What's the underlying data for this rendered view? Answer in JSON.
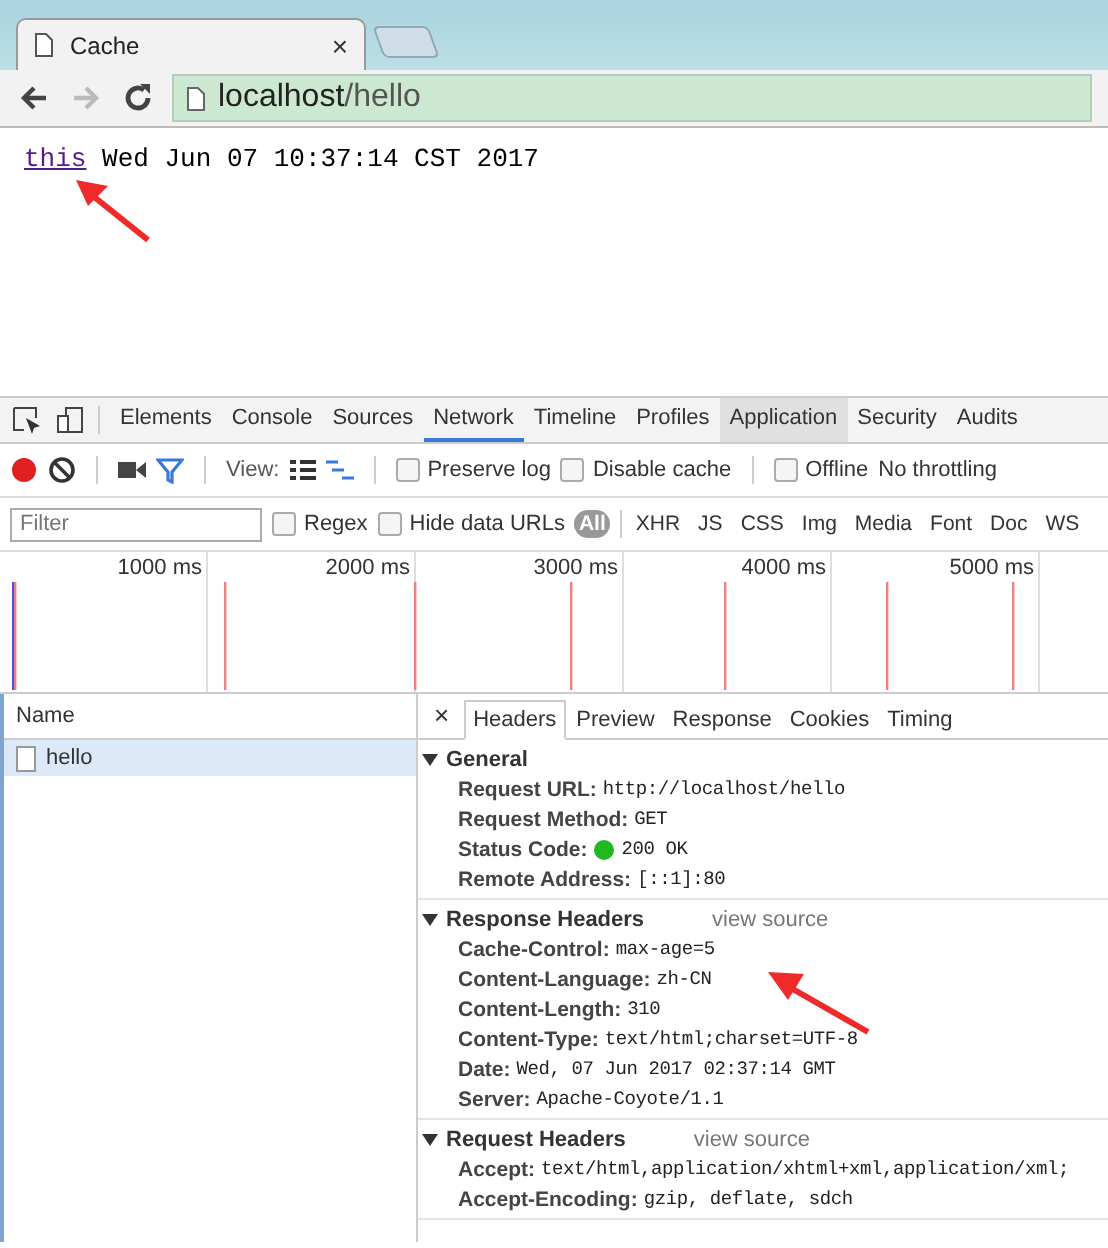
{
  "browser": {
    "tab_title": "Cache",
    "tab_close": "×",
    "address": {
      "host": "localhost",
      "path": "/hello"
    }
  },
  "page": {
    "link": "this",
    "text": "Wed Jun 07 10:37:14 CST 2017"
  },
  "devtools": {
    "panels": [
      {
        "label": "Elements",
        "selected": false
      },
      {
        "label": "Console",
        "selected": false
      },
      {
        "label": "Sources",
        "selected": false
      },
      {
        "label": "Network",
        "selected": true
      },
      {
        "label": "Timeline",
        "selected": false
      },
      {
        "label": "Profiles",
        "selected": false
      },
      {
        "label": "Application",
        "selected": false
      },
      {
        "label": "Security",
        "selected": false
      },
      {
        "label": "Audits",
        "selected": false
      }
    ],
    "toolbar": {
      "recording": true,
      "view_label": "View:",
      "options": [
        {
          "label": "Preserve log",
          "checked": false
        },
        {
          "label": "Disable cache",
          "checked": false
        },
        {
          "label": "Offline",
          "checked": false
        }
      ],
      "throttling": "No throttling"
    },
    "filter": {
      "placeholder": "Filter",
      "options": [
        {
          "label": "Regex",
          "checked": false
        },
        {
          "label": "Hide data URLs",
          "checked": false
        }
      ],
      "types": [
        {
          "label": "All",
          "selected": true
        },
        {
          "label": "XHR",
          "selected": false
        },
        {
          "label": "JS",
          "selected": false
        },
        {
          "label": "CSS",
          "selected": false
        },
        {
          "label": "Img",
          "selected": false
        },
        {
          "label": "Media",
          "selected": false
        },
        {
          "label": "Font",
          "selected": false
        },
        {
          "label": "Doc",
          "selected": false
        },
        {
          "label": "WS",
          "selected": false
        }
      ]
    },
    "timeline_ticks": [
      "1000 ms",
      "2000 ms",
      "3000 ms",
      "4000 ms",
      "5000 ms"
    ],
    "requests": {
      "column": "Name",
      "rows": [
        {
          "name": "hello",
          "selected": true
        }
      ]
    },
    "details": {
      "close": "×",
      "tabs": [
        {
          "label": "Headers",
          "selected": true
        },
        {
          "label": "Preview",
          "selected": false
        },
        {
          "label": "Response",
          "selected": false
        },
        {
          "label": "Cookies",
          "selected": false
        },
        {
          "label": "Timing",
          "selected": false
        }
      ],
      "sections": [
        {
          "title": "General",
          "expanded": true,
          "rows": [
            {
              "key": "Request URL:",
              "value": "http://localhost/hello"
            },
            {
              "key": "Request Method:",
              "value": "GET"
            },
            {
              "key": "Status Code:",
              "value": "200 OK",
              "color": "#22b822"
            },
            {
              "key": "Remote Address:",
              "value": "[::1]:80"
            }
          ]
        },
        {
          "title": "Response Headers",
          "expanded": true,
          "link": "view source",
          "rows": [
            {
              "key": "Cache-Control:",
              "value": "max-age=5"
            },
            {
              "key": "Content-Language:",
              "value": "zh-CN"
            },
            {
              "key": "Content-Length:",
              "value": "310"
            },
            {
              "key": "Content-Type:",
              "value": "text/html;charset=UTF-8"
            },
            {
              "key": "Date:",
              "value": "Wed, 07 Jun 2017 02:37:14 GMT"
            },
            {
              "key": "Server:",
              "value": "Apache-Coyote/1.1"
            }
          ]
        },
        {
          "title": "Request Headers",
          "expanded": true,
          "link": "view source",
          "rows": [
            {
              "key": "Accept:",
              "value": "text/html,application/xhtml+xml,application/xml;"
            },
            {
              "key": "Accept-Encoding:",
              "value": "gzip, deflate, sdch"
            }
          ]
        }
      ]
    }
  }
}
